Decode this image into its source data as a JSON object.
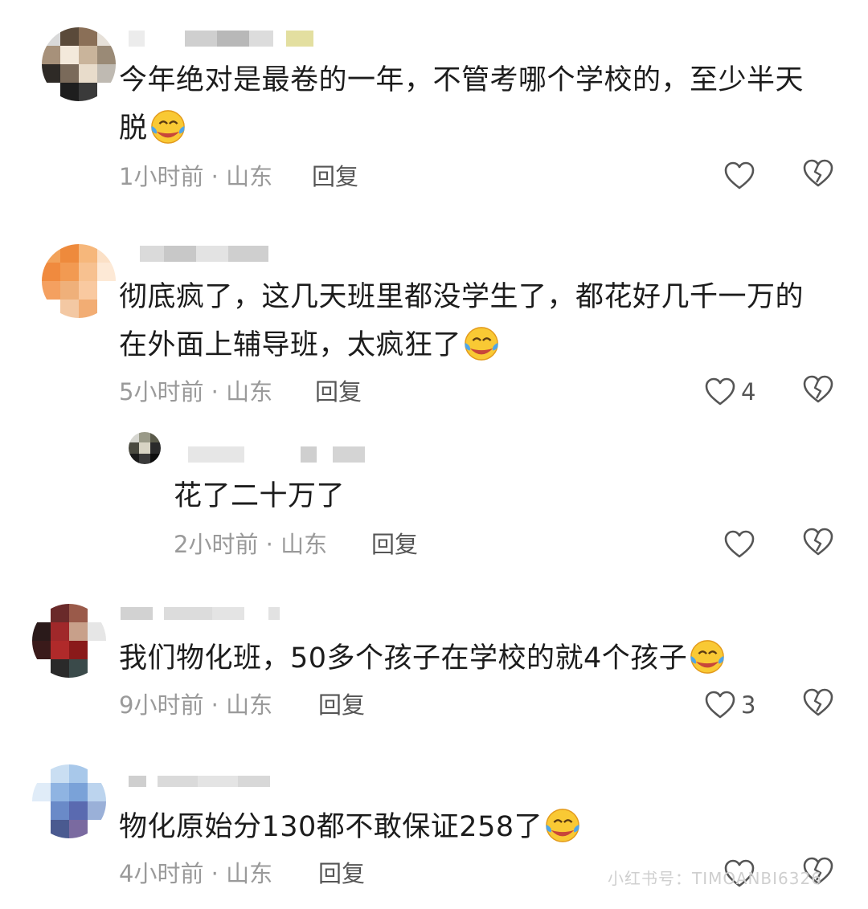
{
  "comments": [
    {
      "text": "今年绝对是最卷的一年，不管考哪个学校的，至少半天脱",
      "line1": "今年绝对是最卷的一年，不管考哪个学校的，至少半天",
      "line2": "脱",
      "emoji": "face-with-tears-of-joy",
      "time": "1小时前",
      "location": "山东",
      "reply_label": "回复",
      "like_count": ""
    },
    {
      "text": "彻底疯了，这几天班里都没学生了，都花好几千一万的在外面上辅导班，太疯狂了",
      "line1": "彻底疯了，这几天班里都没学生了，都花好几千一万的",
      "line2": "在外面上辅导班，太疯狂了",
      "emoji": "face-with-tears-of-joy",
      "time": "5小时前",
      "location": "山东",
      "reply_label": "回复",
      "like_count": "4",
      "replies": [
        {
          "text": "花了二十万了",
          "time": "2小时前",
          "location": "山东",
          "reply_label": "回复",
          "like_count": ""
        }
      ]
    },
    {
      "text": "我们物化班，50多个孩子在学校的就4个孩子",
      "emoji": "face-with-tears-of-joy",
      "time": "9小时前",
      "location": "山东",
      "reply_label": "回复",
      "like_count": "3"
    },
    {
      "text": "物化原始分130都不敢保证258了",
      "emoji": "face-with-tears-of-joy",
      "time": "4小时前",
      "location": "山东",
      "reply_label": "回复",
      "like_count": ""
    }
  ],
  "separator": " · ",
  "watermark": "小红书号：TIMOANBI6326",
  "icons": {
    "like": "heart-outline-icon",
    "dislike": "broken-heart-outline-icon"
  },
  "colors": {
    "text": "#1c1c1c",
    "meta": "#9a9a9a",
    "action": "#555555"
  }
}
